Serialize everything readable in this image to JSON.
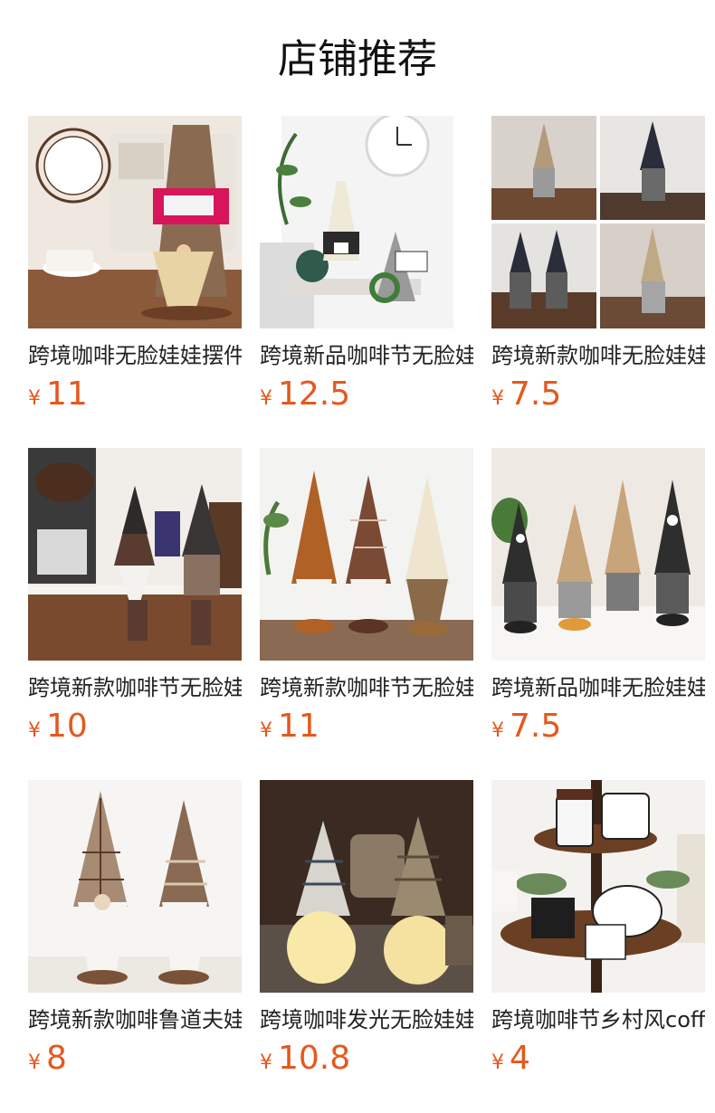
{
  "section": {
    "title": "店铺推荐"
  },
  "colors": {
    "price": "#e5581d",
    "title": "#111111",
    "text": "#222222"
  },
  "products": [
    {
      "name": "跨境咖啡无脸娃娃摆件",
      "currency": "¥",
      "price": "11",
      "image": "gnome-coffee-wine-bottle-cover"
    },
    {
      "name": "跨境新品咖啡节无脸娃娃",
      "currency": "¥",
      "price": "12.5",
      "image": "gnome-pair-home-sign"
    },
    {
      "name": "跨境新款咖啡无脸娃娃",
      "currency": "¥",
      "price": "7.5",
      "image": "gnome-collage-four"
    },
    {
      "name": "跨境新款咖啡节无脸娃娃",
      "currency": "¥",
      "price": "10",
      "image": "gnome-pair-coffee-bar"
    },
    {
      "name": "跨境新款咖啡节无脸娃娃",
      "currency": "¥",
      "price": "11",
      "image": "gnome-trio-beans"
    },
    {
      "name": "跨境新品咖啡无脸娃娃",
      "currency": "¥",
      "price": "7.5",
      "image": "gnome-four-grey-tan"
    },
    {
      "name": "跨境新款咖啡鲁道夫娃娃",
      "currency": "¥",
      "price": "8",
      "image": "gnome-pair-plaid"
    },
    {
      "name": "跨境咖啡发光无脸娃娃",
      "currency": "¥",
      "price": "10.8",
      "image": "gnome-pair-glowing"
    },
    {
      "name": "跨境咖啡节乡村风coffee",
      "currency": "¥",
      "price": "4",
      "image": "tiered-tray-coffee-signs"
    }
  ]
}
